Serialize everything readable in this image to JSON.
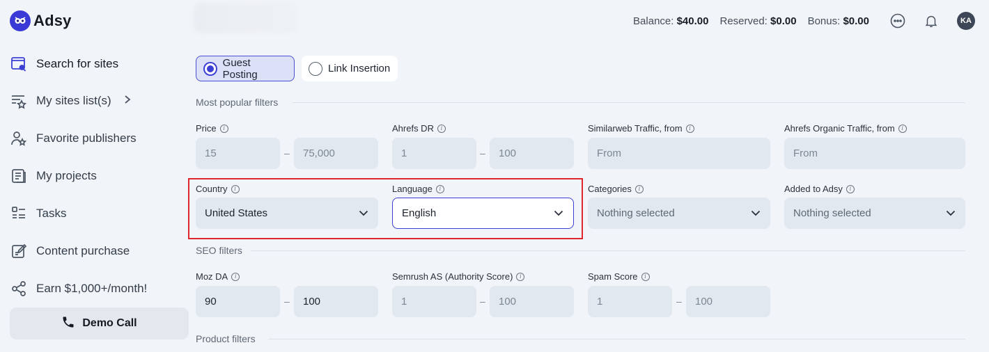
{
  "app": {
    "name": "Adsy"
  },
  "sidebar": {
    "items": [
      {
        "label": "Search for sites",
        "icon": "search-sites-icon"
      },
      {
        "label": "My sites list(s)",
        "icon": "list-star-icon"
      },
      {
        "label": "Favorite publishers",
        "icon": "user-star-icon"
      },
      {
        "label": "My projects",
        "icon": "document-icon"
      },
      {
        "label": "Tasks",
        "icon": "tasks-icon"
      },
      {
        "label": "Content purchase",
        "icon": "edit-document-icon"
      },
      {
        "label": "Earn $1,000+/month!",
        "icon": "share-icon"
      }
    ],
    "demo_call": "Demo Call"
  },
  "topbar": {
    "balance_label": "Balance:",
    "balance_value": "$40.00",
    "reserved_label": "Reserved:",
    "reserved_value": "$0.00",
    "bonus_label": "Bonus:",
    "bonus_value": "$0.00",
    "avatar_initials": "KA"
  },
  "tabs": {
    "guest_posting": "Guest Posting",
    "link_insertion": "Link Insertion",
    "selected": "Guest Posting"
  },
  "popular": {
    "title": "Most popular filters",
    "price": {
      "label": "Price",
      "from": "15",
      "to": "75,000"
    },
    "ahrefs_dr": {
      "label": "Ahrefs DR",
      "from": "1",
      "to": "100"
    },
    "similarweb": {
      "label": "Similarweb Traffic, from",
      "placeholder": "From"
    },
    "ahrefs_organic": {
      "label": "Ahrefs Organic Traffic, from",
      "placeholder": "From"
    },
    "country": {
      "label": "Country",
      "value": "United States"
    },
    "language": {
      "label": "Language",
      "value": "English"
    },
    "categories": {
      "label": "Categories",
      "value": "Nothing selected"
    },
    "added": {
      "label": "Added to Adsy",
      "value": "Nothing selected"
    }
  },
  "seo": {
    "title": "SEO filters",
    "moz_da": {
      "label": "Moz DA",
      "from": "90",
      "to": "100"
    },
    "semrush": {
      "label": "Semrush AS (Authority Score)",
      "from": "1",
      "to": "100"
    },
    "spam": {
      "label": "Spam Score",
      "from": "1",
      "to": "100"
    }
  },
  "product": {
    "title": "Product filters"
  },
  "separator": "–",
  "colors": {
    "accent": "#3b3fd4",
    "highlight": "#e0262a",
    "field_bg": "#e2e8f0",
    "page_bg": "#f1f4f8"
  }
}
